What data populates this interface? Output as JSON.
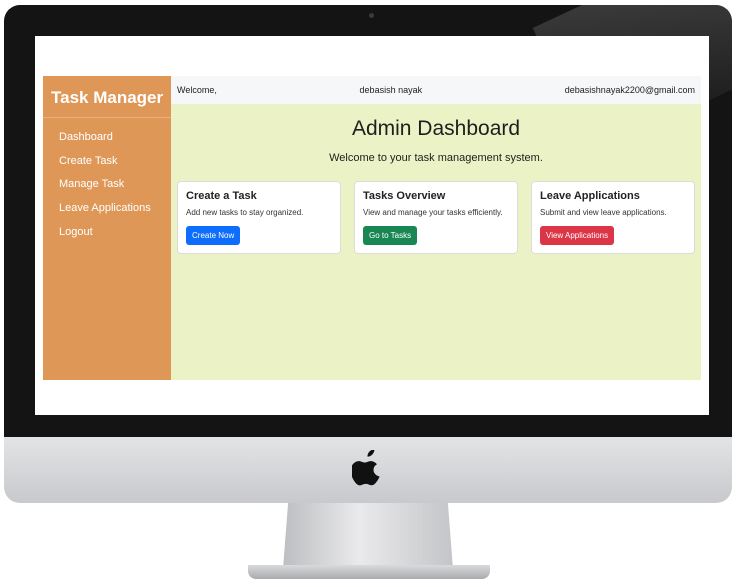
{
  "sidebar": {
    "brand": "Task Manager",
    "items": [
      {
        "label": "Dashboard"
      },
      {
        "label": "Create Task"
      },
      {
        "label": "Manage Task"
      },
      {
        "label": "Leave Applications"
      },
      {
        "label": "Logout"
      }
    ]
  },
  "topbar": {
    "welcome": "Welcome,",
    "user_name": "debasish nayak",
    "email": "debasishnayak2200@gmail.com"
  },
  "main": {
    "title": "Admin Dashboard",
    "subtitle": "Welcome to your task management system."
  },
  "cards": [
    {
      "title": "Create a Task",
      "text": "Add new tasks to stay organized.",
      "button": "Create Now",
      "button_color": "#0d6efd"
    },
    {
      "title": "Tasks Overview",
      "text": "View and manage your tasks efficiently.",
      "button": "Go to Tasks",
      "button_color": "#198754"
    },
    {
      "title": "Leave Applications",
      "text": "Submit and view leave applications.",
      "button": "View Applications",
      "button_color": "#dc3545"
    }
  ],
  "colors": {
    "sidebar": "#df9757",
    "main_background": "#ebf3c6"
  },
  "icons": {
    "monitor_logo": "apple-logo-icon"
  }
}
